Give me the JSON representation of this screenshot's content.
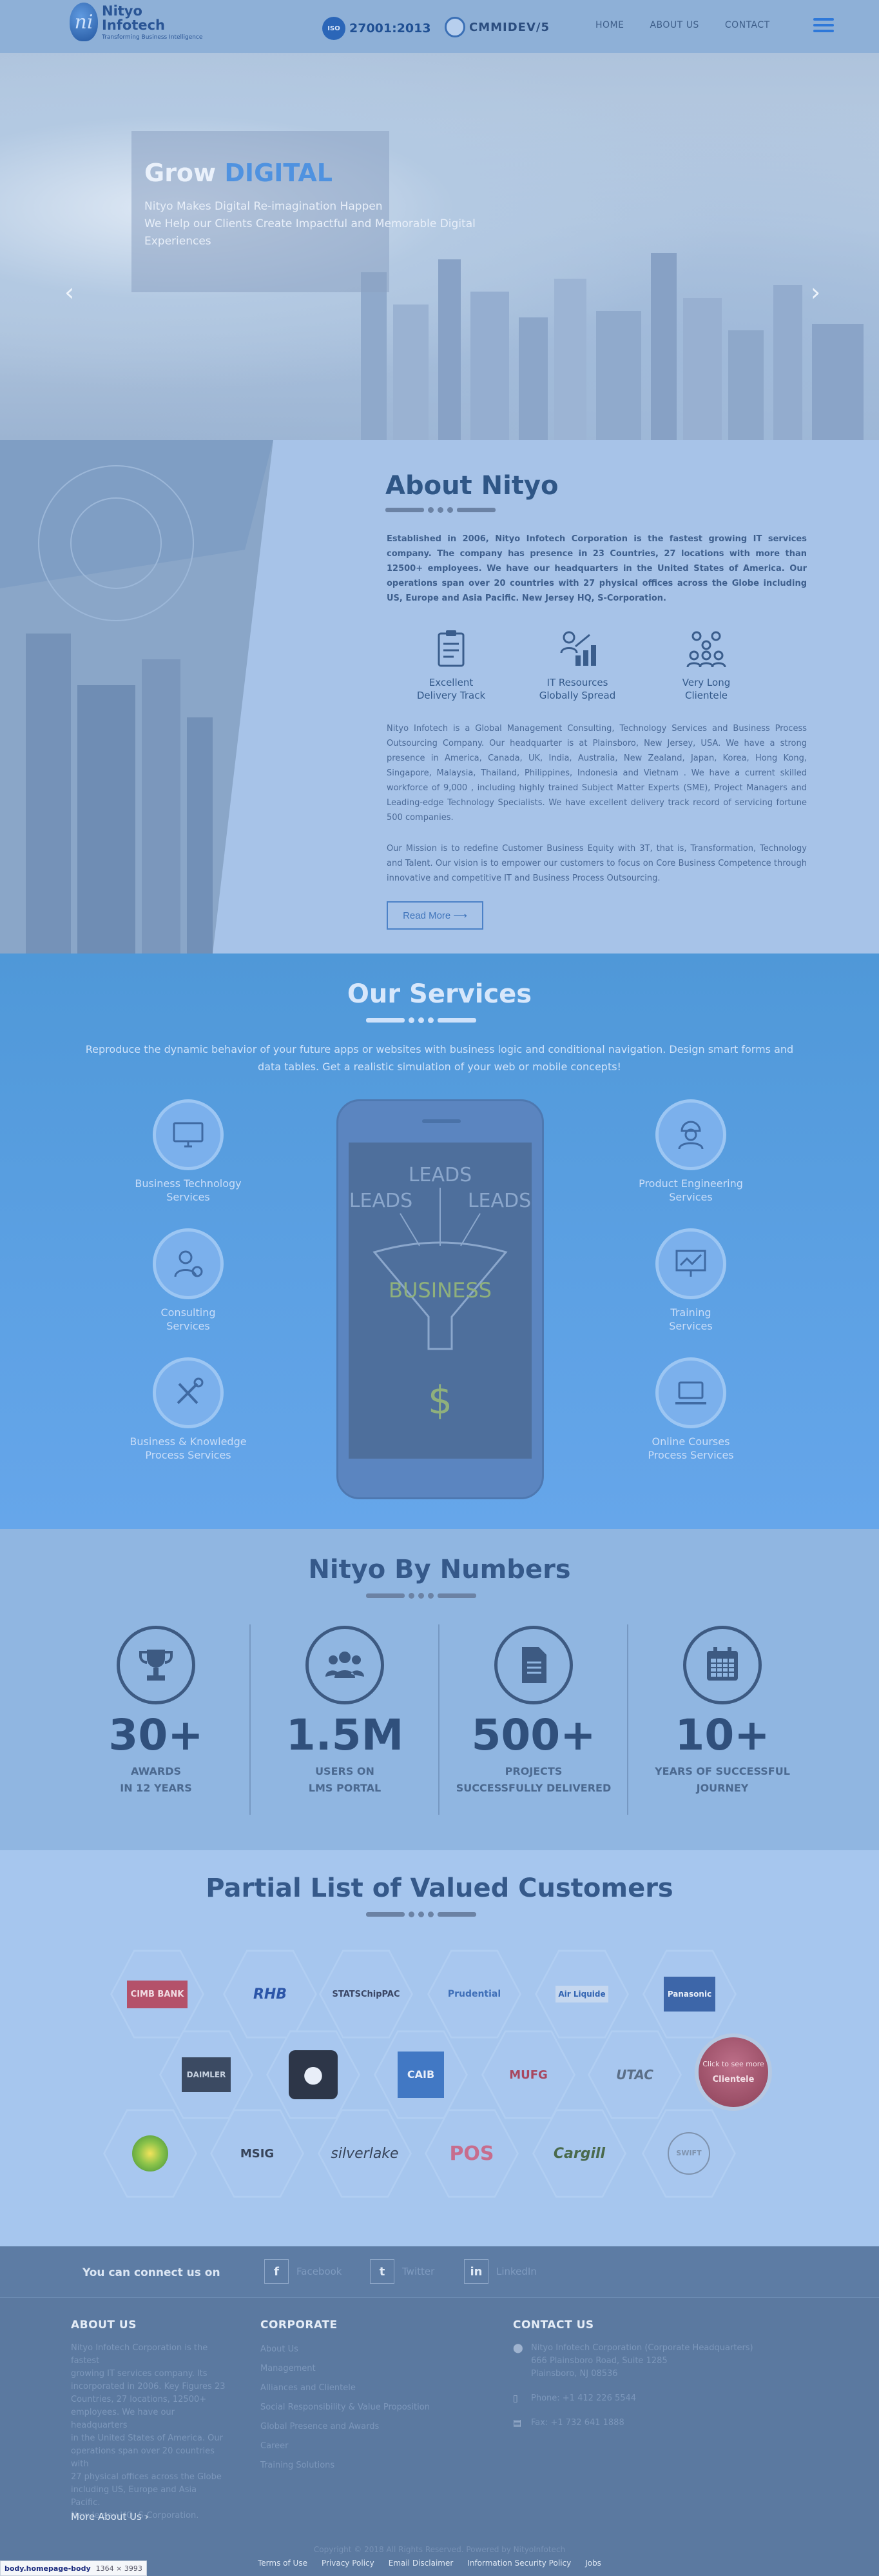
{
  "header": {
    "logo_name_1": "Nityo",
    "logo_name_2": "Infotech",
    "logo_tagline": "Transforming Business Intelligence",
    "iso_badge": "ISO",
    "iso_text": "27001:2013",
    "cmmi_text": "CMMIDEV/5",
    "nav": [
      "HOME",
      "ABOUT US",
      "CONTACT"
    ]
  },
  "hero": {
    "title_plain": "Grow",
    "title_accent": "DIGITAL",
    "line1": "Nityo Makes Digital Re-imagination Happen",
    "line2": "We Help our Clients Create Impactful and Memorable Digital",
    "line3": "Experiences",
    "prev_arrow": "‹",
    "next_arrow": "›"
  },
  "about": {
    "title": "About Nityo",
    "intro": "Established in 2006, Nityo Infotech Corporation is the fastest growing IT services company. The company has presence in 23 Countries, 27 locations with more than 12500+ employees. We have our headquarters in the United States of America. Our operations span over 20 countries with 27 physical offices across the Globe including US, Europe and Asia Pacific. New Jersey HQ, S-Corporation.",
    "features": [
      {
        "line1": "Excellent",
        "line2": "Delivery Track",
        "icon": "clipboard-icon"
      },
      {
        "line1": "IT Resources",
        "line2": "Globally Spread",
        "icon": "growth-chart-icon"
      },
      {
        "line1": "Very Long",
        "line2": "Clientele",
        "icon": "people-group-icon"
      }
    ],
    "para2": "Nityo Infotech is a Global Management Consulting, Technology Services and Business Process Outsourcing Company. Our headquarter is at Plainsboro, New Jersey, USA. We have a strong presence in America, Canada, UK, India, Australia, New Zealand, Japan, Korea, Hong Kong, Singapore, Malaysia, Thailand, Philippines, Indonesia and Vietnam . We have a current skilled workforce of 9,000 , including highly trained Subject Matter Experts (SME), Project Managers and Leading-edge Technology Specialists. We have excellent delivery track record of servicing fortune 500 companies.",
    "para3": "Our Mission is to redefine Customer Business Equity with 3T, that is, Transformation, Technology and Talent. Our vision is to empower our customers to focus on Core Business Competence through innovative and competitive IT and Business Process Outsourcing.",
    "read_more": "Read More ⟶"
  },
  "services": {
    "title": "Our Services",
    "subtitle": "Reproduce the dynamic behavior of your future apps or websites with business logic and conditional navigation. Design smart forms and data tables. Get a realistic simulation of your web or mobile concepts!",
    "items": [
      {
        "line1": "Business Technology",
        "line2": "Services",
        "icon": "monitor-icon"
      },
      {
        "line1": "Consulting",
        "line2": "Services",
        "icon": "consultant-icon"
      },
      {
        "line1": "Business & Knowledge",
        "line2": "Process Services",
        "icon": "tools-icon"
      },
      {
        "line1": "Product Engineering",
        "line2": "Services",
        "icon": "engineer-icon"
      },
      {
        "line1": "Training",
        "line2": "Services",
        "icon": "presentation-icon"
      },
      {
        "line1": "Online Courses",
        "line2": "Process Services",
        "icon": "laptop-icon"
      }
    ],
    "phone": {
      "leads_top": "LEADS",
      "leads_left": "LEADS",
      "leads_right": "LEADS",
      "funnel": "BUSINESS",
      "money": "$"
    }
  },
  "numbers": {
    "title": "Nityo By Numbers",
    "items": [
      {
        "value": "30+",
        "line1": "AWARDS",
        "line2": "IN 12 YEARS",
        "icon": "trophy-icon"
      },
      {
        "value": "1.5M",
        "line1": "USERS ON",
        "line2": "LMS PORTAL",
        "icon": "users-icon"
      },
      {
        "value": "500+",
        "line1": "PROJECTS",
        "line2": "SUCCESSFULLY DELIVERED",
        "icon": "document-icon"
      },
      {
        "value": "10+",
        "line1": "YEARS OF SUCCESSFUL",
        "line2": "JOURNEY",
        "icon": "calendar-icon"
      }
    ]
  },
  "customers": {
    "title": "Partial List of Valued Customers",
    "row1": [
      {
        "name": "CIMB BANK",
        "color": "#b4516a"
      },
      {
        "name": "RHB",
        "color": "#2b55a8"
      },
      {
        "name": "STATSChipPAC",
        "color": "#3b4766"
      },
      {
        "name": "Prudential",
        "color": "#3f6fb8"
      },
      {
        "name": "Air Liquide",
        "color": "#3264b2"
      },
      {
        "name": "Panasonic",
        "color": "#e8eef8"
      }
    ],
    "row2": [
      {
        "name": "DAIMLER",
        "color": "#c7d2e0"
      },
      {
        "name": "",
        "color": "#e8eef8"
      },
      {
        "name": "CAIB",
        "color": "#e8eef8"
      },
      {
        "name": "MUFG",
        "color": "#a8475f"
      },
      {
        "name": "UTAC",
        "color": "#5b6f88"
      }
    ],
    "row3": [
      {
        "name": "",
        "color": "#5da145"
      },
      {
        "name": "MSIG",
        "color": "#37445a"
      },
      {
        "name": "silverlake",
        "color": "#37445a"
      },
      {
        "name": "POS",
        "color": "#c76d8d"
      },
      {
        "name": "Cargill",
        "color": "#4a6a4d"
      },
      {
        "name": "SWIFT",
        "color": "#7f93ae"
      }
    ],
    "clientele_t1": "Click to see more",
    "clientele_t2": "Clientele"
  },
  "footer": {
    "connect": "You can connect us on",
    "social": [
      {
        "glyph": "f",
        "label": "Facebook"
      },
      {
        "glyph": "t",
        "label": "Twitter"
      },
      {
        "glyph": "in",
        "label": "LinkedIn"
      }
    ],
    "about_head": "ABOUT US",
    "about_text": [
      "Nityo Infotech Corporation is the fastest",
      "growing IT services company. Its",
      "incorporated in 2006. Key Figures 23",
      "Countries, 27 locations, 12500+",
      "employees. We have our headquarters",
      "in the United States of America. Our",
      "operations span over 20 countries with",
      "27 physical offices across the Globe",
      "including US, Europe and Asia Pacific.",
      "New Jersey HQ, S-Corporation."
    ],
    "more_about": "More About Us  ›",
    "corporate_head": "CORPORATE",
    "corporate_links": [
      "About Us",
      "Management",
      "Alliances and Clientele",
      "Social Responsibility & Value Proposition",
      "Global Presence and Awards",
      "Career",
      "Training Solutions"
    ],
    "contact_head": "CONTACT US",
    "address": [
      "Nityo Infotech Corporation (Corporate Headquarters)",
      "666 Plainsboro Road, Suite 1285",
      "Plainsboro, NJ 08536"
    ],
    "phone": "Phone: +1 412 226 5544",
    "fax": "Fax: +1 732 641 1888",
    "copyright": "Copyright © 2018 All Rights Reserved. Powered by NityoInfotech",
    "bottom_links": [
      "Terms of Use",
      "Privacy Policy",
      "Email Disclaimer",
      "Information Security Policy",
      "Jobs"
    ]
  },
  "devtools": {
    "element": "body.homepage-body",
    "size": "1364 × 3993"
  }
}
